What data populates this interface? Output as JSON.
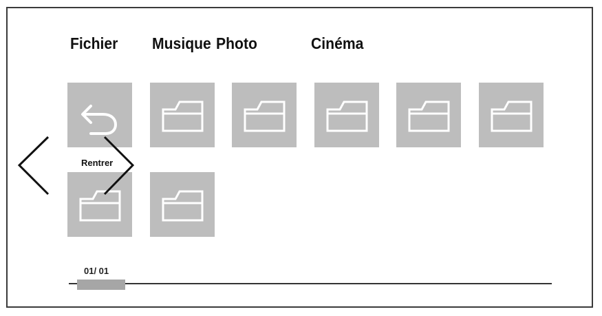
{
  "tabs": [
    {
      "label": "Fichier"
    },
    {
      "label": "Musique"
    },
    {
      "label": "Photo"
    },
    {
      "label": "Cinéma"
    }
  ],
  "grid": {
    "back_tile": {
      "label": "Rentrer",
      "icon": "back-arrow-icon"
    },
    "folder_icon": "folder-icon",
    "folder_count": 7
  },
  "navigation": {
    "prev_icon": "chevron-left-icon",
    "next_icon": "chevron-right-icon"
  },
  "pagination": {
    "text": "01/  01",
    "current": 1,
    "total": 1
  },
  "colors": {
    "tile": "#bdbdbd",
    "icon": "#ffffff",
    "frame": "#3a3a3a",
    "thumb": "#a6a6a6"
  }
}
